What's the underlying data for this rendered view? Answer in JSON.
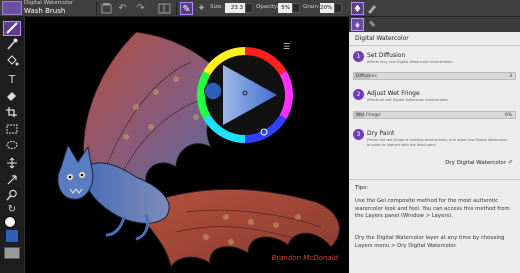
{
  "brush": {
    "category": "Digital Watercolor",
    "name": "Wash Brush"
  },
  "toolbar": {
    "size_label": "Size:",
    "size_value": "23.3",
    "opacity_label": "Opacity:",
    "opacity_value": "5%",
    "grain_label": "Grain:",
    "grain_value": "20%",
    "opacity_level": 0.05,
    "grain_level": 0.2
  },
  "icons": {
    "top": [
      "brush-tile-icon",
      "reset-icon",
      "undo-icon",
      "redo-icon",
      "brush-properties-icon",
      "dab-icon",
      "panel-toggle-icon",
      "layers-icon"
    ],
    "left_tools": [
      "brush-tool-icon",
      "dropper-icon",
      "paint-bucket-icon",
      "text-icon",
      "eraser-icon",
      "crop-icon",
      "rect-select-icon",
      "lasso-icon",
      "move-icon",
      "transform-icon",
      "magnifier-icon",
      "rotate-icon",
      "grabber-icon"
    ]
  },
  "colors": {
    "accent": "#6f3fb8",
    "main_color": "#2f60b8",
    "additional_color": "#ffffff",
    "paper_color": "#9b9b9b",
    "signature": "#c8402c"
  },
  "panel": {
    "title": "Digital Watercolor",
    "steps": [
      {
        "num": "1",
        "title": "Set Diffusion",
        "desc": "Affects only new Digital Watercolor brushstrokes.",
        "slider_label": "Diffusion:",
        "slider_value": "3"
      },
      {
        "num": "2",
        "title": "Adjust Wet Fringe",
        "desc": "Affects all wet Digital Watercolor brushstrokes.",
        "slider_label": "Wet Fringe:",
        "slider_value": "6%"
      },
      {
        "num": "3",
        "title": "Dry Paint",
        "desc": "Freeze the wet fringe of existing brushstrokes, and allow new Digital Watercolor brushes to interact with the dried paint."
      }
    ],
    "dry_button": "Dry Digital Watercolor",
    "tips_title": "Tips:",
    "tips": [
      "Use the Gel composite method for the most authentic watercolor look and feel. You can access this method from the Layers panel (Window > Layers).",
      "Dry the Digital Watercolor layer at any time by choosing Layers menu > Dry Digital Watercolor."
    ]
  },
  "signature": "Brandon McDonald"
}
